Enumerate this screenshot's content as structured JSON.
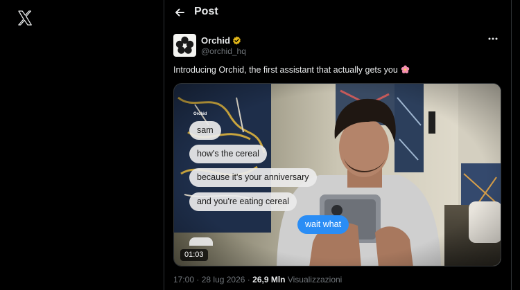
{
  "sidebar": {
    "logo_icon": "x-logo-icon"
  },
  "header": {
    "title": "Post",
    "back_icon": "back-arrow-icon"
  },
  "author": {
    "display_name": "Orchid",
    "handle": "@orchid_hq",
    "verified": true,
    "avatar_icon": "orchid-logo-icon"
  },
  "post": {
    "text": "Introducing Orchid, the first assistant that actually gets you",
    "emoji_icon": "cherry-blossom-icon"
  },
  "media": {
    "overlay_brand": "Orchid",
    "incoming_messages": [
      "sam",
      "how's the cereal",
      "because it's your anniversary",
      "and you're eating cereal"
    ],
    "outgoing_message": "wait what",
    "duration": "01:03"
  },
  "meta": {
    "time": "17:00",
    "separator": "·",
    "date": "28 lug 2026",
    "views_count": "26,9 Mln",
    "views_label": "Visualizzazioni"
  },
  "colors": {
    "background": "#000000",
    "text": "#e7e9ea",
    "muted": "#71767b",
    "verified": "#e2b719",
    "outgoing_bubble": "#2a8df5"
  }
}
